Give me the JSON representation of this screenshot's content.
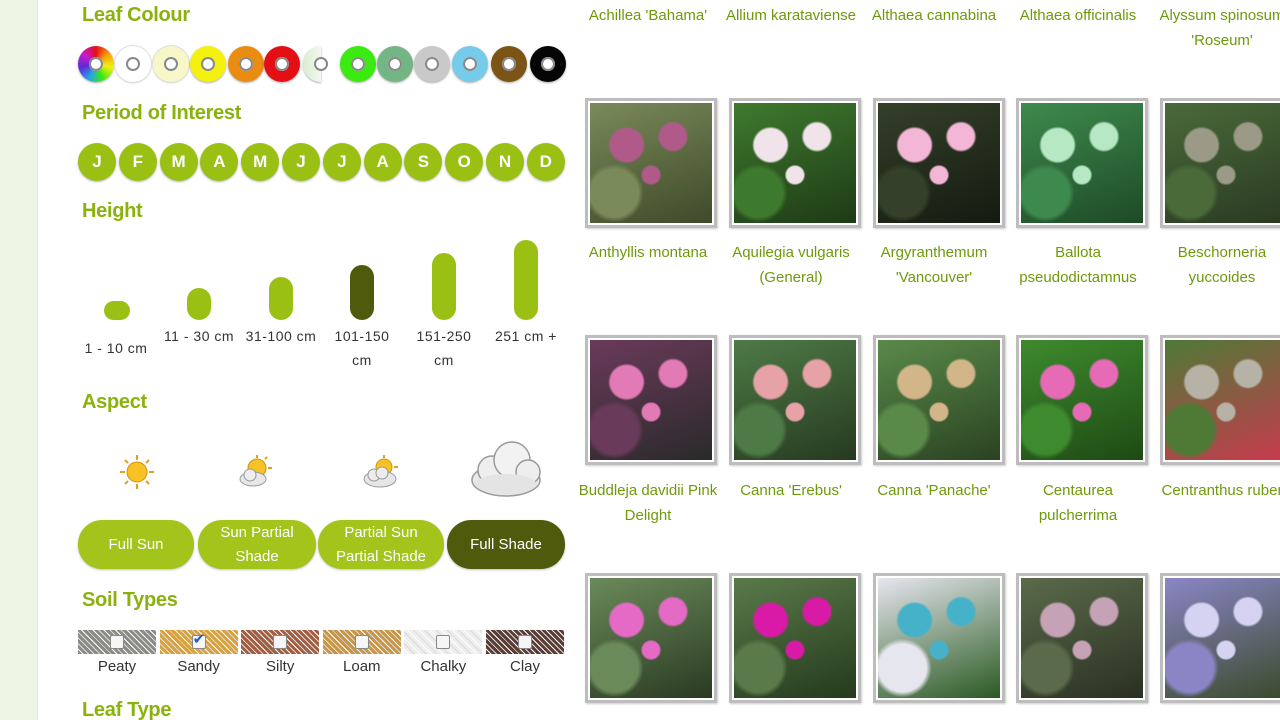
{
  "filters": {
    "leaf_colour": {
      "heading": "Leaf Colour",
      "swatches": [
        {
          "name": "multicolour",
          "color": "rainbow"
        },
        {
          "name": "white",
          "color": "#ffffff"
        },
        {
          "name": "cream",
          "color": "#f7f7c8"
        },
        {
          "name": "yellow",
          "color": "#f4f10e"
        },
        {
          "name": "orange",
          "color": "#ea8c12"
        },
        {
          "name": "red",
          "color": "#e40f14"
        },
        {
          "name": "variegated",
          "color": "#e7f3df"
        },
        {
          "name": "bright-green",
          "color": "#3bea10"
        },
        {
          "name": "mid-green",
          "color": "#74b586"
        },
        {
          "name": "grey",
          "color": "#c9c9c9"
        },
        {
          "name": "blue",
          "color": "#77cbea"
        },
        {
          "name": "brown",
          "color": "#7b5416"
        },
        {
          "name": "black",
          "color": "#050505"
        }
      ]
    },
    "period_of_interest": {
      "heading": "Period of Interest",
      "months": [
        "J",
        "F",
        "M",
        "A",
        "M",
        "J",
        "J",
        "A",
        "S",
        "O",
        "N",
        "D"
      ]
    },
    "height": {
      "heading": "Height",
      "options": [
        {
          "label": "1 - 10  cm",
          "level": 1,
          "selected": false
        },
        {
          "label": "11 - 30 cm",
          "level": 2,
          "selected": false
        },
        {
          "label": "31-100 cm",
          "level": 3,
          "selected": false
        },
        {
          "label": "101-150 cm",
          "level": 4,
          "selected": true
        },
        {
          "label": "151-250 cm",
          "level": 5,
          "selected": false
        },
        {
          "label": "251  cm +",
          "level": 6,
          "selected": false
        }
      ]
    },
    "aspect": {
      "heading": "Aspect",
      "options": [
        {
          "label": "Full Sun",
          "icon": "sun-icon",
          "selected": false
        },
        {
          "label": "Sun Partial Shade",
          "icon": "sun-cloud-icon",
          "selected": false
        },
        {
          "label": "Partial Sun Partial Shade",
          "icon": "cloud-sun-icon",
          "selected": false
        },
        {
          "label": "Full Shade",
          "icon": "cloud-icon",
          "selected": true
        }
      ]
    },
    "soil_types": {
      "heading": "Soil Types",
      "options": [
        {
          "label": "Peaty",
          "checked": false,
          "texture": "#8b8b86"
        },
        {
          "label": "Sandy",
          "checked": true,
          "texture": "#d9a03c"
        },
        {
          "label": "Silty",
          "checked": false,
          "texture": "#a25c3f"
        },
        {
          "label": "Loam",
          "checked": false,
          "texture": "#c89546"
        },
        {
          "label": "Chalky",
          "checked": false,
          "texture": "#eeeeee"
        },
        {
          "label": "Clay",
          "checked": false,
          "texture": "#5a3c34"
        }
      ]
    },
    "leaf_type": {
      "heading": "Leaf Type"
    }
  },
  "plants": {
    "row1_names": [
      "Achillea 'Bahama'",
      "Allium karataviense",
      "Althaea cannabina",
      "Althaea officinalis",
      "Alyssum spinosum 'Roseum'"
    ],
    "row2": [
      {
        "name": "Anthyllis montana",
        "colors": [
          "#b05a8a",
          "#7a8a5a",
          "#3e4a2a"
        ]
      },
      {
        "name": "Aquilegia vulgaris (General)",
        "colors": [
          "#f0e4ea",
          "#3e7a2e",
          "#1e3a16"
        ]
      },
      {
        "name": "Argyranthemum 'Vancouver'",
        "colors": [
          "#f3b6d6",
          "#34402a",
          "#141a10"
        ]
      },
      {
        "name": "Ballota pseudodictamnus",
        "colors": [
          "#b6e8c4",
          "#3e8a4e",
          "#1e4a26"
        ]
      },
      {
        "name": "Beschorneria yuccoides",
        "colors": [
          "#9a9a86",
          "#4a6a3a",
          "#2a3a22"
        ]
      }
    ],
    "row3": [
      {
        "name": "Buddleja davidii Pink Delight",
        "colors": [
          "#e27ab6",
          "#6a3a5a",
          "#2a2a2a"
        ]
      },
      {
        "name": "Canna 'Erebus'",
        "colors": [
          "#e6a2a6",
          "#4e7a46",
          "#263a20"
        ]
      },
      {
        "name": "Canna 'Panache'",
        "colors": [
          "#d2b68a",
          "#5a8a4a",
          "#2a4222"
        ]
      },
      {
        "name": "Centaurea pulcherrima",
        "colors": [
          "#e66ab6",
          "#3e8a2e",
          "#1e4a14"
        ]
      },
      {
        "name": "Centranthus ruber",
        "colors": [
          "#b6b2a6",
          "#4e7a36",
          "#c83a4e"
        ]
      }
    ],
    "row4": [
      {
        "colors": [
          "#e46ac6",
          "#6a8a5a",
          "#2a3a22"
        ]
      },
      {
        "colors": [
          "#d81aa6",
          "#5a7a4a",
          "#243a1c"
        ]
      },
      {
        "colors": [
          "#46b2ca",
          "#e6e6ee",
          "#2a5a22"
        ]
      },
      {
        "colors": [
          "#c6a2b6",
          "#5a6a4a",
          "#2a3022"
        ]
      },
      {
        "colors": [
          "#d6d2f2",
          "#8a86c6",
          "#3a4a2a"
        ]
      }
    ]
  }
}
